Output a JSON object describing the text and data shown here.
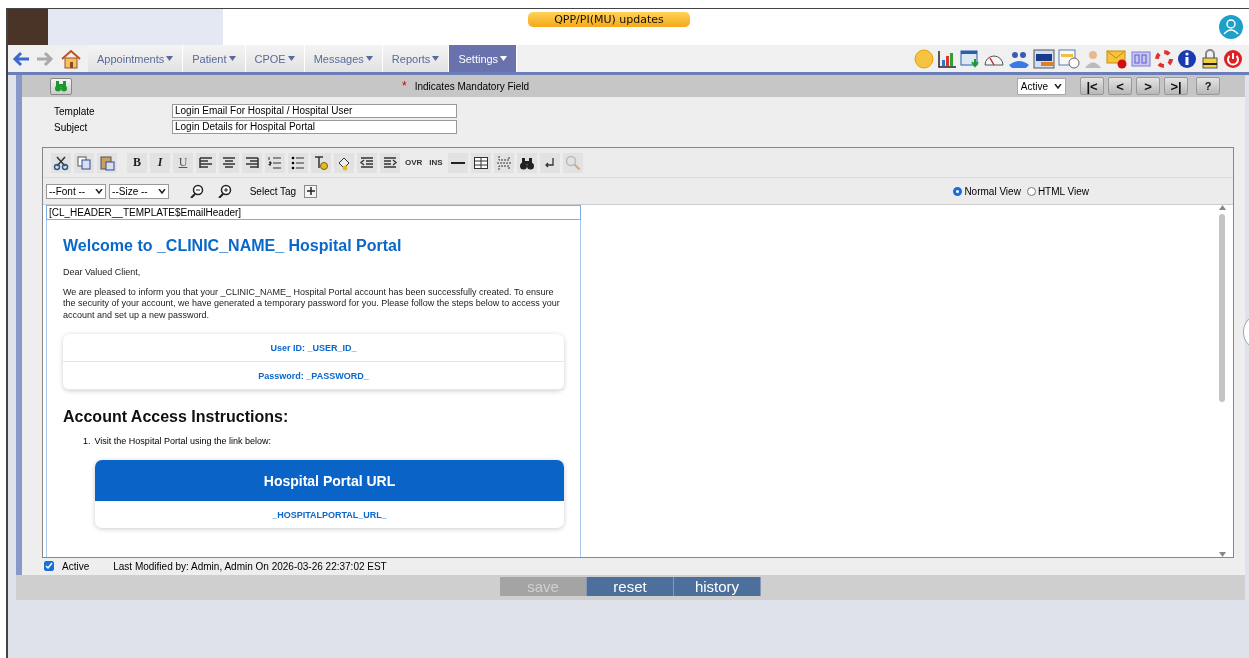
{
  "header": {
    "updates_button": "QPP/PI(MU) updates"
  },
  "nav": {
    "menus": [
      {
        "label": "Appointments",
        "selected": false
      },
      {
        "label": "Patient",
        "selected": false
      },
      {
        "label": "CPOE",
        "selected": false
      },
      {
        "label": "Messages",
        "selected": false
      },
      {
        "label": "Reports",
        "selected": false
      },
      {
        "label": "Settings",
        "selected": true
      }
    ]
  },
  "toolbar": {
    "mandatory_mark": "*",
    "mandatory_note": "Indicates Mandatory Field",
    "status_select": "Active",
    "pager_buttons": [
      "|<",
      "<",
      ">",
      ">|",
      "?"
    ]
  },
  "form": {
    "fields": [
      {
        "label": "Template",
        "value": "Login Email For Hospital / Hospital User"
      },
      {
        "label": "Subject",
        "value": "Login Details for Hospital Portal"
      }
    ]
  },
  "editor": {
    "format_buttons": [
      "B",
      "I",
      "U"
    ],
    "mode_buttons": [
      "OVR",
      "INS"
    ],
    "font_select": "--Font --",
    "size_select": "--Size --",
    "select_tag": "Select Tag",
    "views": [
      {
        "label": "Normal View",
        "selected": true
      },
      {
        "label": "HTML View",
        "selected": false
      }
    ],
    "content": {
      "header_tag": "[CL_HEADER__TEMPLATE$EmailHeader]",
      "title": "Welcome to _CLINIC_NAME_ Hospital Portal",
      "greeting": "Dear Valued Client,",
      "intro": "We are pleased to inform you that your _CLINIC_NAME_ Hospital Portal account has been successfully created. To ensure the security of your account, we have generated a temporary password for you. Please follow the steps below to access your account and set up a new password.",
      "credentials": [
        "User ID: _USER_ID_",
        "Password: _PASSWORD_"
      ],
      "section_title": "Account Access Instructions:",
      "steps": [
        {
          "marker": "1.",
          "text": "Visit the Hospital Portal using the link below:"
        }
      ],
      "url_card": {
        "title": "Hospital Portal URL",
        "link": "_HOSPITALPORTAL_URL_"
      }
    }
  },
  "footer": {
    "active": {
      "label": "Active",
      "checked": true
    },
    "last_modified": "Last Modified by: Admin, Admin On 2026-03-26 22:37:02 EST",
    "buttons": [
      {
        "label": "save",
        "disabled": true
      },
      {
        "label": "reset",
        "disabled": false
      },
      {
        "label": "history",
        "disabled": false
      }
    ]
  }
}
